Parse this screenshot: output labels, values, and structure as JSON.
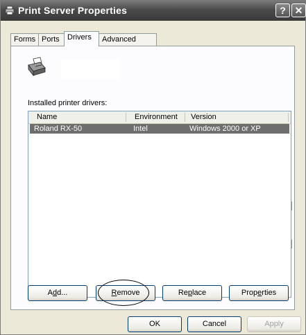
{
  "window": {
    "title": "Print Server Properties"
  },
  "titlebar": {
    "help_label": "?",
    "close_label": "✕"
  },
  "tabs": [
    {
      "label": "Forms",
      "active": false
    },
    {
      "label": "Ports",
      "active": false
    },
    {
      "label": "Drivers",
      "active": true
    },
    {
      "label": "Advanced",
      "active": false
    }
  ],
  "drivers": {
    "section_label": "Installed printer drivers:",
    "columns": [
      "Name",
      "Environment",
      "Version"
    ],
    "rows": [
      {
        "name": "Roland RX-50",
        "environment": "Intel",
        "version": "Windows 2000 or XP",
        "selected": true
      }
    ]
  },
  "buttons": {
    "add": {
      "pre": "A",
      "accel": "d",
      "post": "d..."
    },
    "remove": {
      "pre": "",
      "accel": "R",
      "post": "emove"
    },
    "replace": {
      "pre": "Re",
      "accel": "p",
      "post": "lace"
    },
    "properties": {
      "pre": "Prop",
      "accel": "e",
      "post": "rties"
    }
  },
  "footer": {
    "ok_label": "OK",
    "cancel_label": "Cancel",
    "apply_label": "Apply"
  },
  "icons": {
    "title": "printer-icon",
    "panel": "printer-icon",
    "help": "help-icon",
    "close": "close-icon"
  }
}
